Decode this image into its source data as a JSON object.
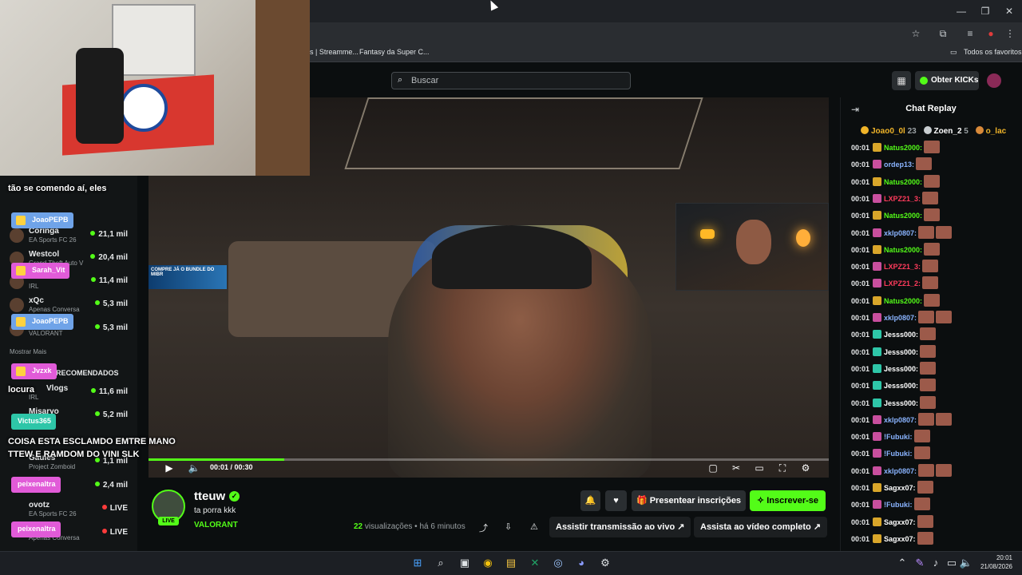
{
  "browser": {
    "bookmarks": [
      "s | Streamme...",
      "Fantasy da Super C..."
    ],
    "all_bookmarks": "Todos os favoritos"
  },
  "nav": {
    "search_placeholder": "Buscar",
    "kicks_button": "Obter KICKs"
  },
  "sidebar": {
    "items": [
      {
        "name": "Coringa",
        "sub": "EA Sports FC 26",
        "viewers": "21,1 mil",
        "live": true
      },
      {
        "name": "Westcol",
        "sub": "Grand Theft Auto V",
        "viewers": "20,4 mil",
        "live": true
      },
      {
        "name": "",
        "sub": "IRL",
        "viewers": "11,4 mil",
        "live": true
      },
      {
        "name": "xQc",
        "sub": "Apenas Conversa",
        "viewers": "5,3 mil",
        "live": true
      },
      {
        "name": "",
        "sub": "VALORANT",
        "viewers": "5,3 mil",
        "live": true
      }
    ],
    "show_more": "Mostrar Mais",
    "recommended": "RECOMENDADOS",
    "rec_items": [
      {
        "name": "Vlogs",
        "sub": "IRL",
        "viewers": "11,6 mil"
      },
      {
        "name": "Misaryo",
        "sub": "",
        "viewers": "5,2 mil"
      },
      {
        "name": "Gaules",
        "sub": "Project Zomboid",
        "viewers": "1,1 mil"
      },
      {
        "name": "",
        "sub": "",
        "viewers": "2,4 mil"
      },
      {
        "name": "ovotz",
        "sub": "EA Sports FC 26",
        "viewers": "LIVE"
      },
      {
        "name": "",
        "sub": "Apenas Conversa",
        "viewers": "LIVE"
      }
    ]
  },
  "overlay_chat": [
    {
      "user": "",
      "msg": "tão se comendo aí, eles",
      "color": "#e15bd8"
    },
    {
      "user": "JoaoPEPB",
      "msg": "",
      "color": "#6fa3e8"
    },
    {
      "user": "Sarah_Vit",
      "msg": "",
      "color": "#e15bd8"
    },
    {
      "user": "JoaoPEPB",
      "msg": "",
      "color": "#6fa3e8"
    },
    {
      "user": "Jvzxk",
      "msg": "locura",
      "color": "#e15bd8"
    },
    {
      "user": "Victus365",
      "msg": "COISA ESTA ESCLAMDO EMTRE MANO TTEW E RAMDOM DO VINI SLK",
      "color": "#2ec6a8"
    },
    {
      "user": "peixenaltra",
      "msg": "",
      "color": "#e15bd8"
    },
    {
      "user": "peixenaltra",
      "msg": "",
      "color": "#e15bd8"
    }
  ],
  "video": {
    "time": "00:01 / 00:30",
    "progress": 0.2,
    "banner": "COMPRE JÁ O BUNDLE DO MIBR"
  },
  "channel": {
    "name": "tteuw",
    "title": "ta porra kkk",
    "category": "VALORANT",
    "live_label": "LIVE",
    "views_count": "22",
    "views_label": "visualizações",
    "ago": "há 6 minutos",
    "gift_label": "Presentear inscrições",
    "subscribe_label": "Inscrever-se",
    "watch_live": "Assistir transmissão ao vivo",
    "watch_full": "Assista ao vídeo completo"
  },
  "chat": {
    "title": "Chat Replay",
    "leaders": [
      {
        "name": "Joao0_0l",
        "count": "23",
        "color": "#f0b429"
      },
      {
        "name": "Zoen_2",
        "count": "5",
        "color": "#c9ced1"
      },
      {
        "name": "o_lac",
        "count": "",
        "color": "#d98a3a"
      }
    ],
    "messages": [
      {
        "t": "00:01",
        "user": "Natus2000:",
        "color": "#53fc18",
        "badge": "#d9a62a",
        "emotes": 1
      },
      {
        "t": "00:01",
        "user": "ordep13:",
        "color": "#8ab4ff",
        "badge": "#c84f9e",
        "emotes": 1
      },
      {
        "t": "00:01",
        "user": "Natus2000:",
        "color": "#53fc18",
        "badge": "#d9a62a",
        "emotes": 1
      },
      {
        "t": "00:01",
        "user": "LXPZ21_3:",
        "color": "#ff3b5c",
        "badge": "#c84f9e",
        "emotes": 1
      },
      {
        "t": "00:01",
        "user": "Natus2000:",
        "color": "#53fc18",
        "badge": "#d9a62a",
        "emotes": 1
      },
      {
        "t": "00:01",
        "user": "xklp0807:",
        "color": "#8ab4ff",
        "badge": "#c84f9e",
        "emotes": 2
      },
      {
        "t": "00:01",
        "user": "Natus2000:",
        "color": "#53fc18",
        "badge": "#d9a62a",
        "emotes": 1
      },
      {
        "t": "00:01",
        "user": "LXPZ21_3:",
        "color": "#ff3b5c",
        "badge": "#c84f9e",
        "emotes": 1
      },
      {
        "t": "00:01",
        "user": "LXPZ21_2:",
        "color": "#ff3b5c",
        "badge": "#c84f9e",
        "emotes": 1
      },
      {
        "t": "00:01",
        "user": "Natus2000:",
        "color": "#53fc18",
        "badge": "#d9a62a",
        "emotes": 1
      },
      {
        "t": "00:01",
        "user": "xklp0807:",
        "color": "#8ab4ff",
        "badge": "#c84f9e",
        "emotes": 2
      },
      {
        "t": "00:01",
        "user": "Jesss000:",
        "color": "#ffffff",
        "badge": "#2ec6a8",
        "emotes": 1
      },
      {
        "t": "00:01",
        "user": "Jesss000:",
        "color": "#ffffff",
        "badge": "#2ec6a8",
        "emotes": 1
      },
      {
        "t": "00:01",
        "user": "Jesss000:",
        "color": "#ffffff",
        "badge": "#2ec6a8",
        "emotes": 1
      },
      {
        "t": "00:01",
        "user": "Jesss000:",
        "color": "#ffffff",
        "badge": "#2ec6a8",
        "emotes": 1
      },
      {
        "t": "00:01",
        "user": "Jesss000:",
        "color": "#ffffff",
        "badge": "#2ec6a8",
        "emotes": 1
      },
      {
        "t": "00:01",
        "user": "xklp0807:",
        "color": "#8ab4ff",
        "badge": "#c84f9e",
        "emotes": 2
      },
      {
        "t": "00:01",
        "user": "!Fubuki:",
        "color": "#8ab4ff",
        "badge": "#c84f9e",
        "emotes": 1
      },
      {
        "t": "00:01",
        "user": "!Fubuki:",
        "color": "#8ab4ff",
        "badge": "#c84f9e",
        "emotes": 1
      },
      {
        "t": "00:01",
        "user": "xklp0807:",
        "color": "#8ab4ff",
        "badge": "#c84f9e",
        "emotes": 2
      },
      {
        "t": "00:01",
        "user": "Sagxx07:",
        "color": "#ffffff",
        "badge": "#d9a62a",
        "emotes": 1
      },
      {
        "t": "00:01",
        "user": "!Fubuki:",
        "color": "#8ab4ff",
        "badge": "#c84f9e",
        "emotes": 1
      },
      {
        "t": "00:01",
        "user": "Sagxx07:",
        "color": "#ffffff",
        "badge": "#d9a62a",
        "emotes": 1
      },
      {
        "t": "00:01",
        "user": "Sagxx07:",
        "color": "#ffffff",
        "badge": "#d9a62a",
        "emotes": 1
      }
    ]
  },
  "taskbar": {
    "time": "20:01",
    "date": "21/08/2026"
  }
}
